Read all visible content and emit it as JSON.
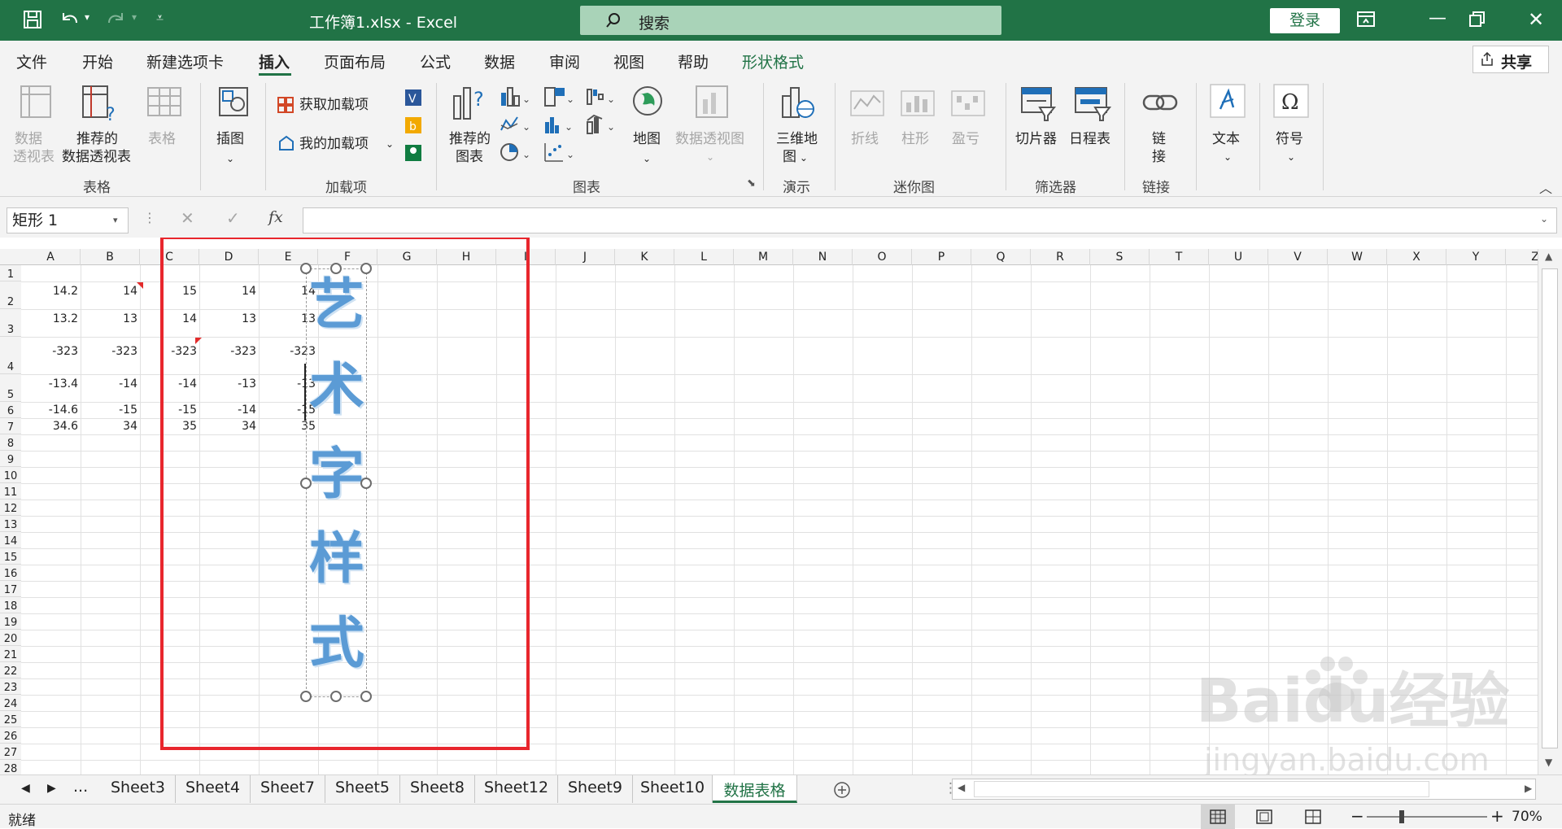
{
  "title": {
    "file": "工作簿1.xlsx",
    "sep": " - ",
    "app": "Excel",
    "search_placeholder": "搜索",
    "login": "登录"
  },
  "menu": [
    "文件",
    "开始",
    "新建选项卡",
    "插入",
    "页面布局",
    "公式",
    "数据",
    "审阅",
    "视图",
    "帮助",
    "形状格式"
  ],
  "share": "共享",
  "ribbon": {
    "pivot": [
      "数据",
      "透视表"
    ],
    "rec_pivot": [
      "推荐的",
      "数据透视表"
    ],
    "table": "表格",
    "illustrations": "插图",
    "get_addins": "获取加载项",
    "my_addins": "我的加载项",
    "rec_charts": [
      "推荐的",
      "图表"
    ],
    "map": "地图",
    "pivot_chart": "数据透视图",
    "map3d": [
      "三维地",
      "图"
    ],
    "line": "折线",
    "column": "柱形",
    "winloss": "盈亏",
    "slicer": "切片器",
    "timeline": "日程表",
    "link": [
      "链",
      "接"
    ],
    "text": "文本",
    "symbol": "符号",
    "groups": {
      "tables": "表格",
      "addins": "加载项",
      "charts": "图表",
      "tours": "演示",
      "sparklines": "迷你图",
      "filters": "筛选器",
      "links": "链接"
    }
  },
  "formula": {
    "namebox": "矩形 1",
    "fx": "fx",
    "cancel": "✕",
    "confirm": "✓"
  },
  "columns": [
    "A",
    "B",
    "C",
    "D",
    "E",
    "F",
    "G",
    "H",
    "I",
    "J",
    "K",
    "L",
    "M",
    "N",
    "O",
    "P",
    "Q",
    "R",
    "S",
    "T",
    "U",
    "V",
    "W",
    "X",
    "Y",
    "Z"
  ],
  "rows": [
    "1",
    "2",
    "3",
    "4",
    "5",
    "6",
    "7",
    "8",
    "9",
    "10",
    "11",
    "12",
    "13",
    "14",
    "15",
    "16",
    "17",
    "18",
    "19",
    "20",
    "21",
    "22",
    "23",
    "24",
    "25",
    "26",
    "27",
    "28"
  ],
  "cells": {
    "r2": [
      "14.2",
      "14",
      "15",
      "14",
      "14"
    ],
    "r3": [
      "13.2",
      "13",
      "14",
      "13",
      "13"
    ],
    "r4": [
      "-323",
      "-323",
      "-323",
      "-323",
      "-323"
    ],
    "r5": [
      "-13.4",
      "-14",
      "-14",
      "-13",
      "-13"
    ],
    "r6": [
      "-14.6",
      "-15",
      "-15",
      "-14",
      "-15"
    ],
    "r7": [
      "34.6",
      "34",
      "35",
      "34",
      "35"
    ]
  },
  "wordart": [
    "艺",
    "术",
    "字",
    "样",
    "式"
  ],
  "sheets": [
    "Sheet3",
    "Sheet4",
    "Sheet7",
    "Sheet5",
    "Sheet8",
    "Sheet12",
    "Sheet9",
    "Sheet10",
    "数据表格"
  ],
  "sheet_more": "...",
  "status": {
    "ready": "就绪",
    "zoom": "70%",
    "minus": "−",
    "plus": "+"
  },
  "watermark": {
    "brand": "Baidu经验",
    "url": "jingyan.baidu.com"
  },
  "colors": {
    "excel_green": "#217346",
    "highlight_red": "#e8262d",
    "wordart_blue": "#5b9bd5"
  }
}
